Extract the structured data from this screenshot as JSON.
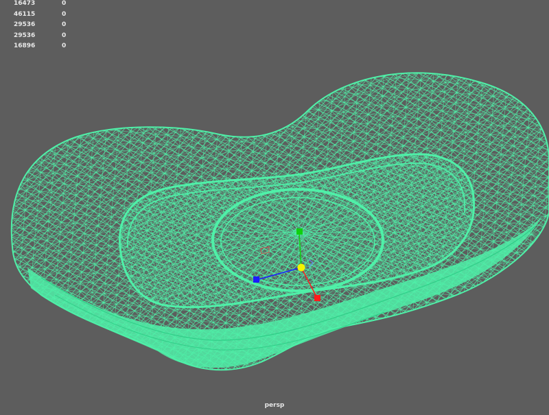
{
  "hud": {
    "rows": [
      {
        "count": "16473",
        "selected": "0"
      },
      {
        "count": "46115",
        "selected": "0"
      },
      {
        "count": "29536",
        "selected": "0"
      },
      {
        "count": "29536",
        "selected": "0"
      },
      {
        "count": "16896",
        "selected": "0"
      }
    ]
  },
  "viewport": {
    "camera": "persp",
    "background_color": "#5d5d5d",
    "wire_color": "#4ff0a8",
    "wire_dark_color": "#2fcf88",
    "axis_colors": {
      "x": "#ff1b1b",
      "y": "#10d010",
      "z": "#1c1cff",
      "center": "#f4f400"
    },
    "icons": [
      "wireframe-mesh",
      "move-manipulator",
      "camera-icon"
    ]
  }
}
